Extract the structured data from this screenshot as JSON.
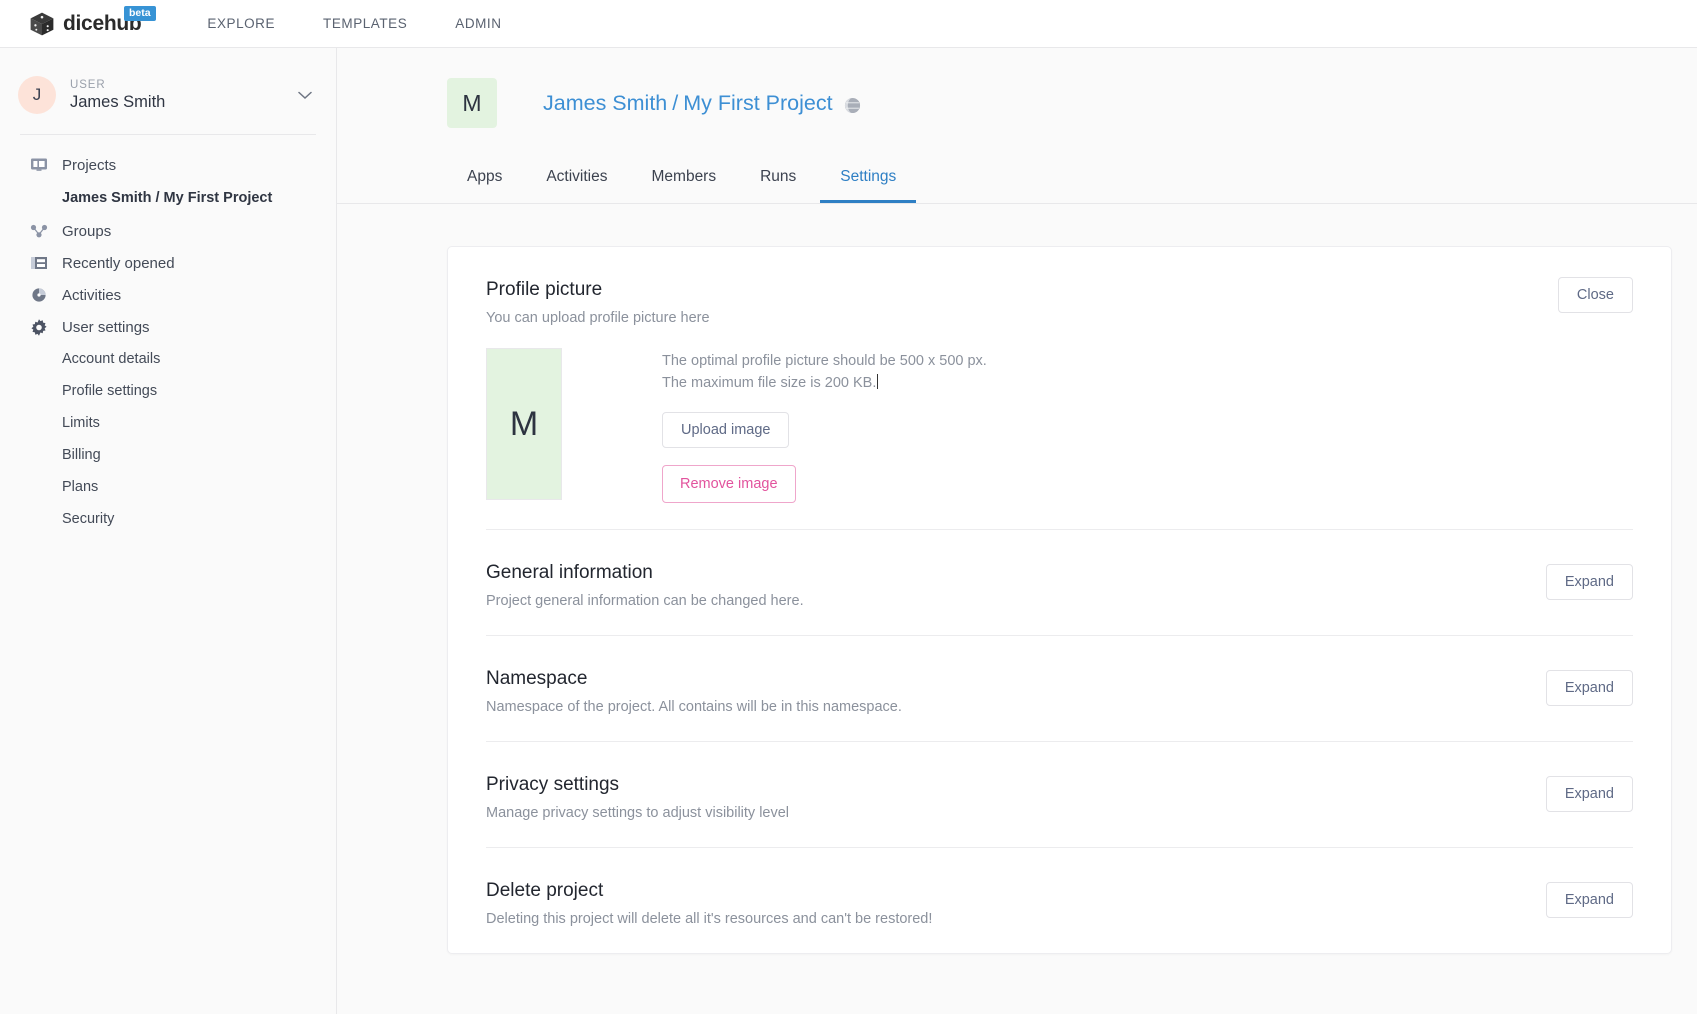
{
  "topbar": {
    "brand_name": "dicehub",
    "beta_badge": "beta",
    "logo_icon": "dice-cube-icon",
    "nav": [
      {
        "label": "EXPLORE",
        "name": "explore"
      },
      {
        "label": "TEMPLATES",
        "name": "templates"
      },
      {
        "label": "ADMIN",
        "name": "admin"
      }
    ]
  },
  "sidebar": {
    "user": {
      "role_label": "USER",
      "name": "James Smith",
      "avatar_initial": "J",
      "avatar_bg": "#fde3d9",
      "chevron_icon": "chevron-down-icon"
    },
    "items": [
      {
        "label": "Projects",
        "icon": "projects-icon",
        "type": "top"
      },
      {
        "label": "James Smith / My First Project",
        "icon": "",
        "type": "sub-bold"
      },
      {
        "label": "Groups",
        "icon": "groups-icon",
        "type": "top"
      },
      {
        "label": "Recently opened",
        "icon": "recently-opened-icon",
        "type": "top"
      },
      {
        "label": "Activities",
        "icon": "activities-icon",
        "type": "top"
      },
      {
        "label": "User settings",
        "icon": "gear-icon",
        "type": "top"
      },
      {
        "label": "Account details",
        "icon": "",
        "type": "sub"
      },
      {
        "label": "Profile settings",
        "icon": "",
        "type": "sub"
      },
      {
        "label": "Limits",
        "icon": "",
        "type": "sub"
      },
      {
        "label": "Billing",
        "icon": "",
        "type": "sub"
      },
      {
        "label": "Plans",
        "icon": "",
        "type": "sub"
      },
      {
        "label": "Security",
        "icon": "",
        "type": "sub"
      }
    ]
  },
  "header": {
    "project_tile_initial": "M",
    "project_tile_bg": "#e3f3e0",
    "breadcrumb_owner": "James Smith",
    "breadcrumb_sep": "/",
    "breadcrumb_project": "My First Project",
    "visibility_icon": "globe-icon",
    "link_color": "#3d8fd4"
  },
  "tabs": [
    {
      "label": "Apps",
      "active": false
    },
    {
      "label": "Activities",
      "active": false
    },
    {
      "label": "Members",
      "active": false
    },
    {
      "label": "Runs",
      "active": false
    },
    {
      "label": "Settings",
      "active": true
    }
  ],
  "settings": {
    "profile_picture": {
      "title": "Profile picture",
      "description": "You can upload profile picture here",
      "close_label": "Close",
      "preview_initial": "M",
      "hint_line1": "The optimal profile picture should be 500 x 500 px.",
      "hint_line2": "The maximum file size is 200 KB.",
      "upload_label": "Upload image",
      "remove_label": "Remove image",
      "remove_color": "#e2539d"
    },
    "sections": [
      {
        "title": "General information",
        "description": "Project general information can be changed here.",
        "action_label": "Expand"
      },
      {
        "title": "Namespace",
        "description": "Namespace of the project. All contains will be in this namespace.",
        "action_label": "Expand"
      },
      {
        "title": "Privacy settings",
        "description": "Manage privacy settings to adjust visibility level",
        "action_label": "Expand"
      },
      {
        "title": "Delete project",
        "description": "Deleting this project will delete all it's resources and can't be restored!",
        "action_label": "Expand"
      }
    ]
  }
}
